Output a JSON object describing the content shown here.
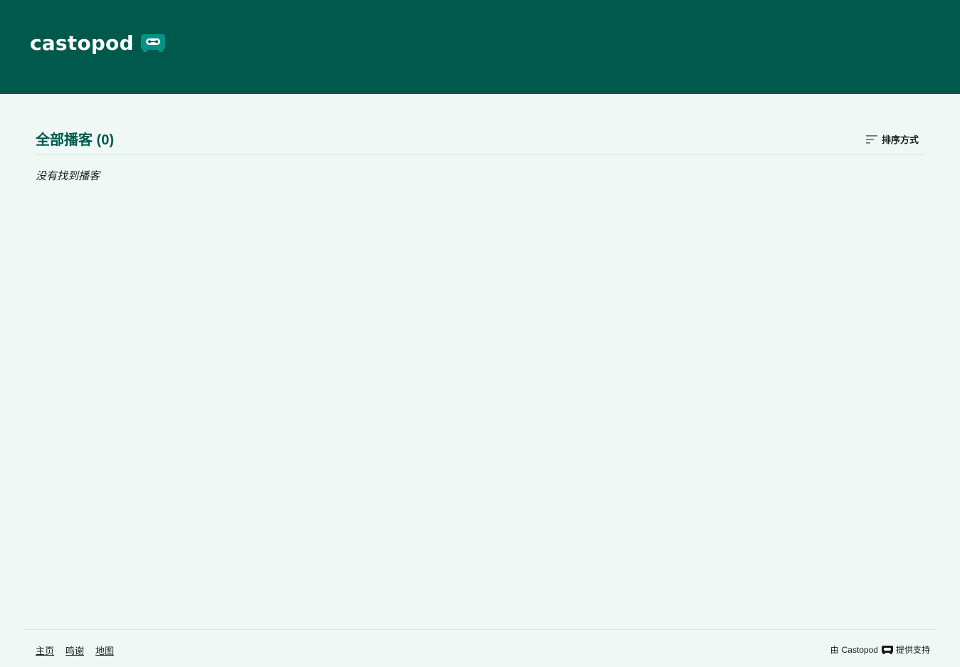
{
  "header": {
    "logo_text": "castopod",
    "logo_icon": "castopod-robot-icon",
    "background": "#00594d"
  },
  "main": {
    "title": "全部播客 (0)",
    "sort_label": "排序方式",
    "sort_icon": "sort-lines-icon",
    "empty_message": "没有找到播客"
  },
  "footer": {
    "links": [
      "主页",
      "鸣谢",
      "地图"
    ],
    "powered_prefix": "由",
    "powered_brand": "Castopod",
    "powered_suffix": "提供支持"
  },
  "colors": {
    "brand": "#00594d",
    "accent": "#009486",
    "page_background": "#eff8f5"
  }
}
